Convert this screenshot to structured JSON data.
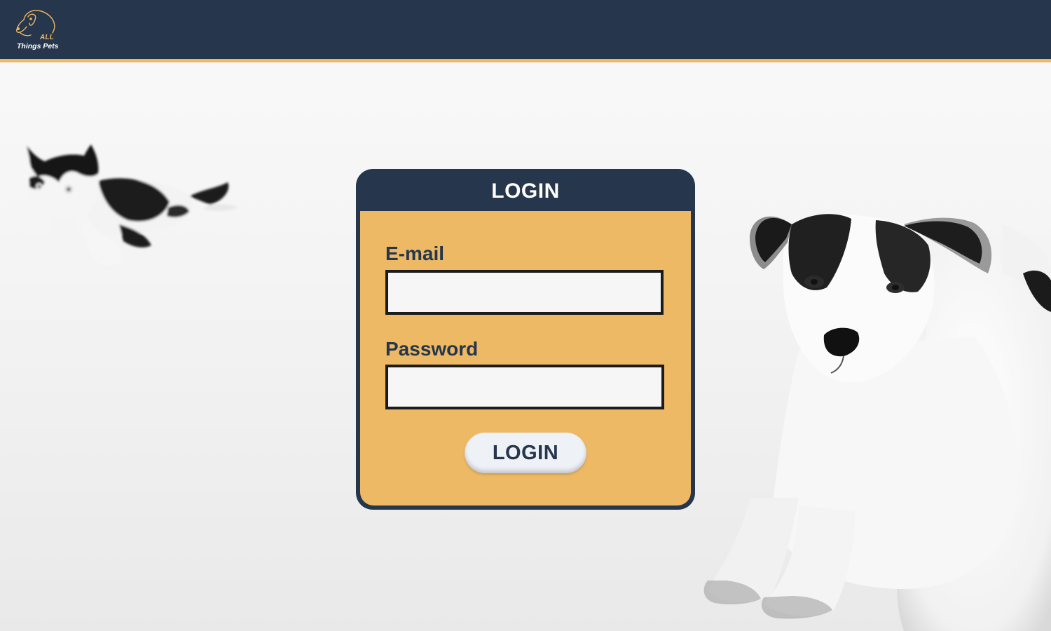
{
  "header": {
    "logo": {
      "icon": "dog-head-icon",
      "word_all": "ALL",
      "word_name": "Things Pets"
    }
  },
  "login_card": {
    "title": "LOGIN",
    "email": {
      "label": "E-mail",
      "value": "",
      "placeholder": ""
    },
    "password": {
      "label": "Password",
      "value": "",
      "placeholder": ""
    },
    "submit_label": "LOGIN"
  },
  "background": {
    "left_image": "cat-photo",
    "right_image": "dog-photo"
  },
  "colors": {
    "navy": "#25364d",
    "gold": "#edb964",
    "input_bg": "#f6f6f6",
    "button_bg": "#eef1f6"
  }
}
